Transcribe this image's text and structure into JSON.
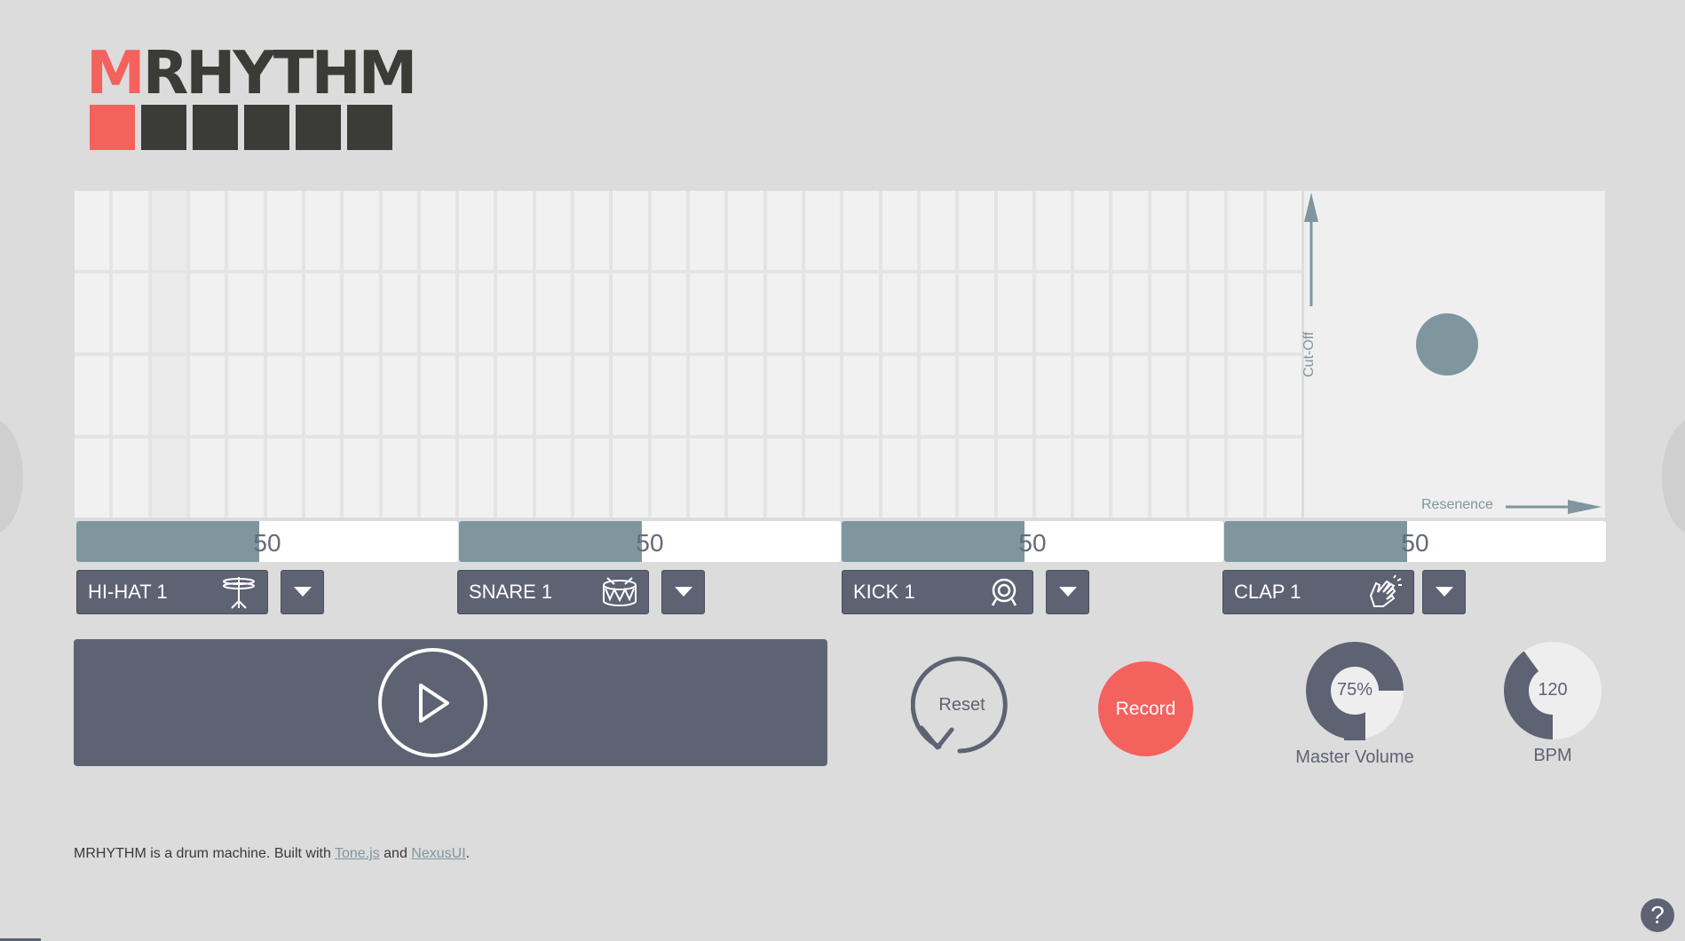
{
  "logo": {
    "first_letter": "M",
    "rest": "RHYTHM",
    "step_squares": [
      true,
      false,
      false,
      false,
      false,
      false
    ]
  },
  "sequencer": {
    "rows": 4,
    "columns": 32
  },
  "xy_pad": {
    "y_label": "Cut-Off",
    "x_label": "Resenence",
    "resonance": 0.48,
    "cutoff": 0.53
  },
  "channels": [
    {
      "level": "50",
      "fill": 0.48,
      "instrument": "HI-HAT 1",
      "icon": "hi-hat-icon"
    },
    {
      "level": "50",
      "fill": 0.48,
      "instrument": "SNARE 1",
      "icon": "snare-drum-icon"
    },
    {
      "level": "50",
      "fill": 0.48,
      "instrument": "KICK 1",
      "icon": "kick-drum-icon"
    },
    {
      "level": "50",
      "fill": 0.48,
      "instrument": "CLAP 1",
      "icon": "clap-hands-icon"
    }
  ],
  "transport": {
    "play_icon": "play-icon",
    "reset_label": "Reset",
    "record_label": "Record"
  },
  "master_volume": {
    "value": "75%",
    "label": "Master Volume",
    "fraction": 0.75
  },
  "bpm": {
    "value": "120",
    "label": "BPM",
    "fraction": 0.4
  },
  "footer": {
    "text_before": "MRHYTHM is a drum machine. Built with ",
    "link1": "Tone.js",
    "text_middle": " and ",
    "link2": "NexusUI",
    "text_after": "."
  },
  "help": {
    "label": "?"
  },
  "colors": {
    "accent": "#f4625d",
    "dark": "#3b3c37",
    "slate": "#5e6373",
    "teal": "#7f969e",
    "background": "#dcdcdc"
  }
}
